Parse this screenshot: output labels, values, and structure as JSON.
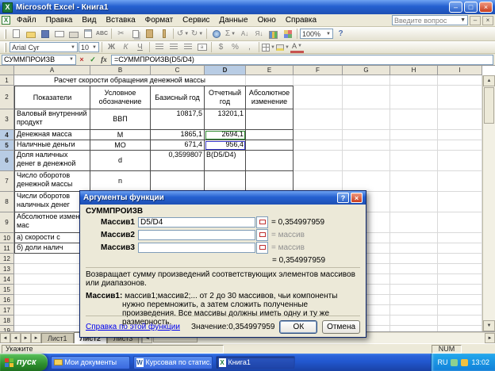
{
  "window": {
    "title": "Microsoft Excel - Книга1"
  },
  "menubar": {
    "items": [
      "Файл",
      "Правка",
      "Вид",
      "Вставка",
      "Формат",
      "Сервис",
      "Данные",
      "Окно",
      "Справка"
    ],
    "question_placeholder": "Введите вопрос"
  },
  "toolbar": {
    "zoom": "100%"
  },
  "formatting": {
    "font_name": "Arial Cyr",
    "font_size": "10",
    "bold": "Ж",
    "italic": "К",
    "underline": "Ч"
  },
  "icons": {
    "dropdown": "▼",
    "up": "▲",
    "down": "▼",
    "left": "◄",
    "right": "►",
    "cancel": "×",
    "enter": "✓",
    "fx": "fx",
    "help": "?",
    "cut": "✂",
    "autosum": "Σ",
    "undo": "↺",
    "redo": "↻",
    "percent": "%",
    "currency": "$",
    "comma": ",",
    "sort_asc": "А↓",
    "sort_desc": "Я↓",
    "font_color": "А",
    "spelling": "ABC",
    "win_min": "–",
    "win_restore": "□",
    "win_close": "×",
    "word_letter": "W",
    "excel_letter": "X"
  },
  "formula_bar": {
    "name_box": "СУММПРОИЗВ",
    "formula": "=СУММПРОИЗВ(D5/D4)"
  },
  "grid": {
    "col_letters": [
      "A",
      "B",
      "C",
      "D",
      "E",
      "F",
      "G",
      "H",
      "I"
    ],
    "row_numbers": [
      "1",
      "2",
      "3",
      "4",
      "5",
      "6",
      "7",
      "8",
      "9",
      "10",
      "11",
      "12",
      "13",
      "14",
      "15",
      "16",
      "17",
      "18",
      "19"
    ],
    "cells": {
      "title": "Расчет скорости обращения денежной массы",
      "h_a": "Показатели",
      "h_b": "Условное обозначение",
      "h_c": "Базисный год",
      "h_d": "Отчетный год",
      "h_e": "Абсолютное изменение",
      "a3": "Валовый внутренний продукт",
      "b3": "ВВП",
      "c3": "10817,5",
      "d3": "13201,1",
      "a4": "Денежная масса",
      "b4": "М",
      "c4": "1865,1",
      "d4": "2694,1",
      "a5": "Наличные деньги",
      "b5": "МО",
      "c5": "671,4",
      "d5": "956,4",
      "a6": "Доля наличных денег в денежной массе",
      "b6": "d",
      "c6": "0,3599807",
      "d6": "В(D5/D4)",
      "a7": "Число оборотов денежной массы",
      "b7": "n",
      "a8": "Числи оборотов наличных денег",
      "a9": "Абсолютное измен\nмас",
      "a10": "а) скорости с",
      "a11": "б) доли налич"
    }
  },
  "dialog": {
    "title": "Аргументы функции",
    "function_name": "СУММПРОИЗВ",
    "args": [
      {
        "label": "Массив1",
        "value": "D5/D4",
        "result": "= 0,354997959"
      },
      {
        "label": "Массив2",
        "value": "",
        "result": "= массив"
      },
      {
        "label": "Массив3",
        "value": "",
        "result": "= массив"
      }
    ],
    "total_result": "= 0,354997959",
    "description": "Возвращает сумму произведений соответствующих элементов массивов или диапазонов.",
    "arg_help_label": "Массив1:",
    "arg_help_text": "массив1;массив2;... от 2 до 30 массивов, чьи компоненты нужно перемножить, а затем сложить полученные произведения. Все массивы должны иметь одну и ту же размерность.",
    "help_link": "Справка по этой функции",
    "value_text": "Значение:0,354997959",
    "ok_label": "ОК",
    "cancel_label": "Отмена"
  },
  "sheet_tabs": {
    "tab1": "Лист1",
    "tab2": "Лист2",
    "tab3": "Лист3"
  },
  "status_bar": {
    "mode": "Укажите",
    "num": "NUM"
  },
  "taskbar": {
    "start_label": "пуск",
    "tasks": [
      {
        "label": "Мои документы"
      },
      {
        "label": "Курсовая по статис..."
      },
      {
        "label": "Книга1"
      }
    ],
    "tray": {
      "lang": "RU",
      "time": "13:02"
    }
  }
}
